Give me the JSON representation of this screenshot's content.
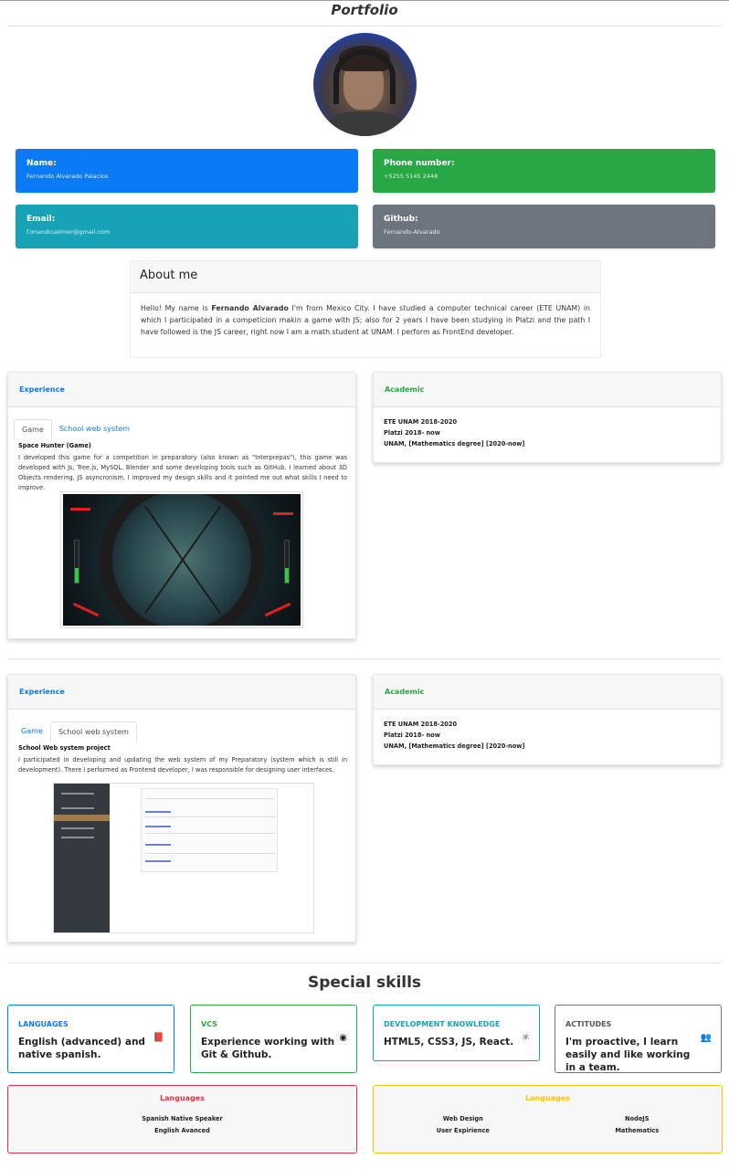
{
  "header": {
    "title": "Portfolio"
  },
  "contact": {
    "name_label": "Name:",
    "name_value": "Fernando Alvarado Palacios",
    "phone_label": "Phone number:",
    "phone_value": "+5255 5145 2448",
    "email_label": "Email:",
    "email_value": "f.Imandcuelmer@gmail.com",
    "github_label": "Github:",
    "github_value": "Fernando-Alvarado"
  },
  "about": {
    "title": "About me",
    "text_before": "Hello! My name is ",
    "name_bold": "Fernando Alvarado",
    "text_after": " I'm from Mexico City. I have studied a computer technical career (ETE UNAM) in which I participated in a competicion makin a game with JS; also for 2 years I have been studying in Platzi and the path I have followed is the JS career, right now I am a math student at UNAM. I perform as FrontEnd developer."
  },
  "section1": {
    "experience_title": "Experience",
    "tab_game": "Game",
    "tab_web": "School web system",
    "project_title": "Space Hunter (Game)",
    "project_desc": "I developed this game for a competition in preparatory (also known as \"Interprepas\"), this game was developed with Js, Tree.js, MySQL, Blender and some developing tools such as GitHub. I learned about 3D Objects rendering, JS asyncronism, I improved my design skills and it pointed me out what skills I need to improve.",
    "academic_title": "Academic",
    "academic": [
      "ETE UNAM 2018-2020",
      "Platzi 2018- now",
      "UNAM, [Mathematics degree] [2020-now]"
    ]
  },
  "section2": {
    "experience_title": "Experience",
    "tab_game": "Game",
    "tab_web": "School web system",
    "project_title": "School Web system project",
    "project_desc": "I participated in developing and updating the web system of my Preparatory (system which is still in development). There I performed as Frontend developer, I was responsible for designing user interfaces.",
    "academic_title": "Academic",
    "academic": [
      "ETE UNAM 2018-2020",
      "Platzi 2018- now",
      "UNAM, [Mathematics degree] [2020-now]"
    ]
  },
  "skills": {
    "title": "Special skills",
    "cards": [
      {
        "category": "LANGUAGES",
        "text": "English (advanced) and native spanish.",
        "icon": "book-icon",
        "glyph": "📕"
      },
      {
        "category": "VCS",
        "text": "Experience working with Git & Github.",
        "icon": "github-icon",
        "glyph": "◉"
      },
      {
        "category": "DEVELOPMENT KNOWLEDGE",
        "text": "HTML5, CSS3, JS, React.",
        "icon": "react-icon",
        "glyph": "⚛"
      },
      {
        "category": "ACTITUDES",
        "text": "I'm proactive, I learn easily and like working in a team.",
        "icon": "users-icon",
        "glyph": "👥"
      }
    ],
    "languages_red": {
      "title": "Languages",
      "items": [
        "Spanish Native Speaker",
        "English Avanced"
      ]
    },
    "languages_yellow": {
      "title": "Languages",
      "col1": [
        "Web Design",
        "User Expirience"
      ],
      "col2": [
        "NodeJS",
        "Mathematics"
      ]
    }
  }
}
